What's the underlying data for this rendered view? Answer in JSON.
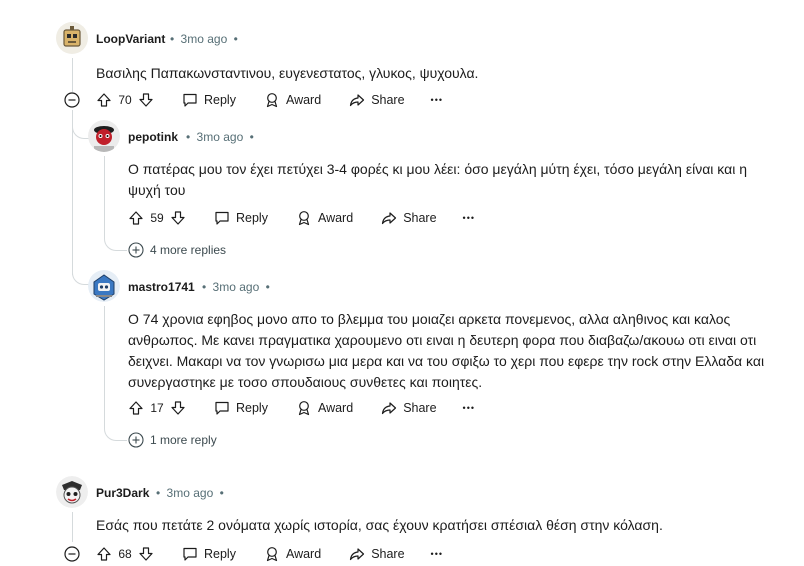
{
  "comments": [
    {
      "username": "LoopVariant",
      "time": "3mo ago",
      "text": "Βασιλης Παπακωνσταντινου, ευγενεστατος, γλυκος, ψυχουλα.",
      "votes": "70"
    },
    {
      "username": "pepotink",
      "time": "3mo ago",
      "text_lines": [
        "Ο πατέρας μου τον έχει πετύχει 3-4 φορές κι μου λέει: όσο μεγάλη μύτη έχει, τόσο μεγάλη είναι και η",
        "ψυχή του"
      ],
      "votes": "59",
      "more_replies": "4 more replies"
    },
    {
      "username": "mastro1741",
      "time": "3mo ago",
      "text_lines": [
        "Ο 74 χρονια εφηβος μονο απο το βλεμμα του μοιαζει αρκετα πονεμενος, αλλα αληθινος και καλος",
        "ανθρωπος. Με κανει πραγματικα χαρουμενο οτι ειναι η δευτερη φορα που διαβαζω/ακουω οτι ειναι οτι",
        "δειχνει. Μακαρι να τον γνωρισω μια μερα και να του σφιξω το χερι που εφερε την rock στην Ελλαδα και",
        "συνεργαστηκε με τοσο σπουδαιους συνθετες και ποιητες."
      ],
      "votes": "17",
      "more_replies": "1 more reply"
    },
    {
      "username": "Pur3Dark",
      "time": "3mo ago",
      "text": "Εσάς που πετάτε 2 ονόματα χωρίς ιστορία, σας έχουν κρατήσει σπέσιαλ θέση στην κόλαση.",
      "votes": "68"
    }
  ],
  "actions": {
    "reply": "Reply",
    "award": "Award",
    "share": "Share",
    "more": "•••",
    "separator": "•"
  },
  "colors": {
    "meta": "#576f76",
    "thread_line": "#d5dadc",
    "text": "#1c1c1c"
  },
  "icons": [
    "upvote-icon",
    "downvote-icon",
    "reply-icon",
    "award-icon",
    "share-icon",
    "more-icon",
    "collapse-icon",
    "expand-icon"
  ]
}
